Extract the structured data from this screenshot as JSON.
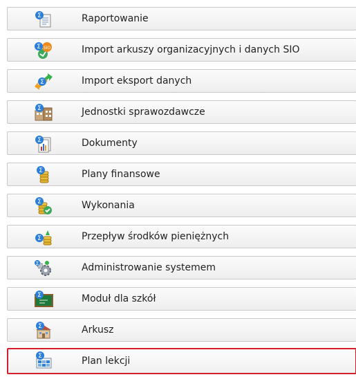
{
  "menu": {
    "items": [
      {
        "label": "Raportowanie",
        "icon": "report-doc-icon"
      },
      {
        "label": "Import arkuszy organizacyjnych i danych SIO",
        "icon": "sio-import-icon"
      },
      {
        "label": "Import eksport danych",
        "icon": "exchange-arrows-icon"
      },
      {
        "label": "Jednostki sprawozdawcze",
        "icon": "buildings-icon"
      },
      {
        "label": "Dokumenty",
        "icon": "documents-chart-icon"
      },
      {
        "label": "Plany finansowe",
        "icon": "coins-icon"
      },
      {
        "label": "Wykonania",
        "icon": "coins-check-icon"
      },
      {
        "label": "Przepływ środków pieniężnych",
        "icon": "coins-flow-icon"
      },
      {
        "label": "Administrowanie systemem",
        "icon": "gears-icon"
      },
      {
        "label": "Moduł dla szkół",
        "icon": "chalkboard-icon"
      },
      {
        "label": "Arkusz",
        "icon": "school-building-icon"
      },
      {
        "label": "Plan lekcji",
        "icon": "lesson-plan-icon"
      }
    ],
    "selected_index": 11
  },
  "colors": {
    "sigma_blue": "#2b7fd8",
    "selected_border": "#d21f2b",
    "item_border": "#c9c9c9"
  }
}
